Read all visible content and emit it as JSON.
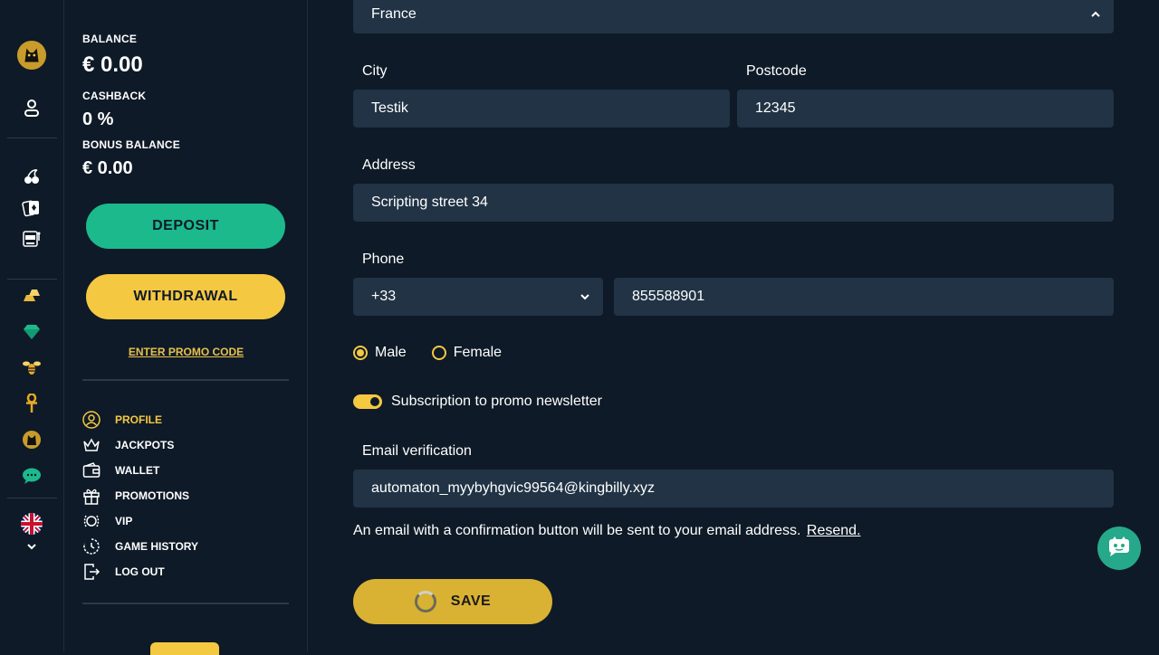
{
  "colors": {
    "accent_yellow": "#f5c842",
    "accent_green": "#1cb98d",
    "field_bg": "#213345",
    "bg": "#0e1a27"
  },
  "rail": {
    "icons": [
      "cat-logo-icon",
      "user-icon",
      "cherries-icon",
      "cards-icon",
      "slot-machine-icon",
      "gold-bars-icon",
      "gem-icon",
      "bee-icon",
      "ankh-icon",
      "cat-icon",
      "chat-bubble-icon",
      "uk-flag-icon",
      "chevron-down-icon"
    ]
  },
  "account": {
    "balance_label": "BALANCE",
    "balance_value": "€ 0.00",
    "cashback_label": "CASHBACK",
    "cashback_value": "0 %",
    "bonus_label": "BONUS BALANCE",
    "bonus_value": "€ 0.00",
    "deposit_label": "DEPOSIT",
    "withdrawal_label": "WITHDRAWAL",
    "promo_label": "ENTER PROMO CODE"
  },
  "menu": [
    {
      "label": "PROFILE",
      "icon": "profile-icon"
    },
    {
      "label": "JACKPOTS",
      "icon": "crown-icon"
    },
    {
      "label": "WALLET",
      "icon": "wallet-icon"
    },
    {
      "label": "PROMOTIONS",
      "icon": "gift-icon"
    },
    {
      "label": "VIP",
      "icon": "laurel-icon"
    },
    {
      "label": "GAME HISTORY",
      "icon": "history-icon"
    },
    {
      "label": "LOG OUT",
      "icon": "logout-icon"
    }
  ],
  "form": {
    "country_value": "France",
    "city_label": "City",
    "city_value": "Testik",
    "postcode_label": "Postcode",
    "postcode_value": "12345",
    "address_label": "Address",
    "address_value": "Scripting street 34",
    "phone_label": "Phone",
    "phone_code": "+33",
    "phone_value": "855588901",
    "gender_male": "Male",
    "gender_female": "Female",
    "newsletter_label": "Subscription to promo newsletter",
    "email_label": "Email verification",
    "email_value": "automaton_myybyhgvic99564@kingbilly.xyz",
    "email_note": "An email with a confirmation button will be sent to your email address.",
    "resend_label": "Resend.",
    "save_label": "SAVE"
  }
}
